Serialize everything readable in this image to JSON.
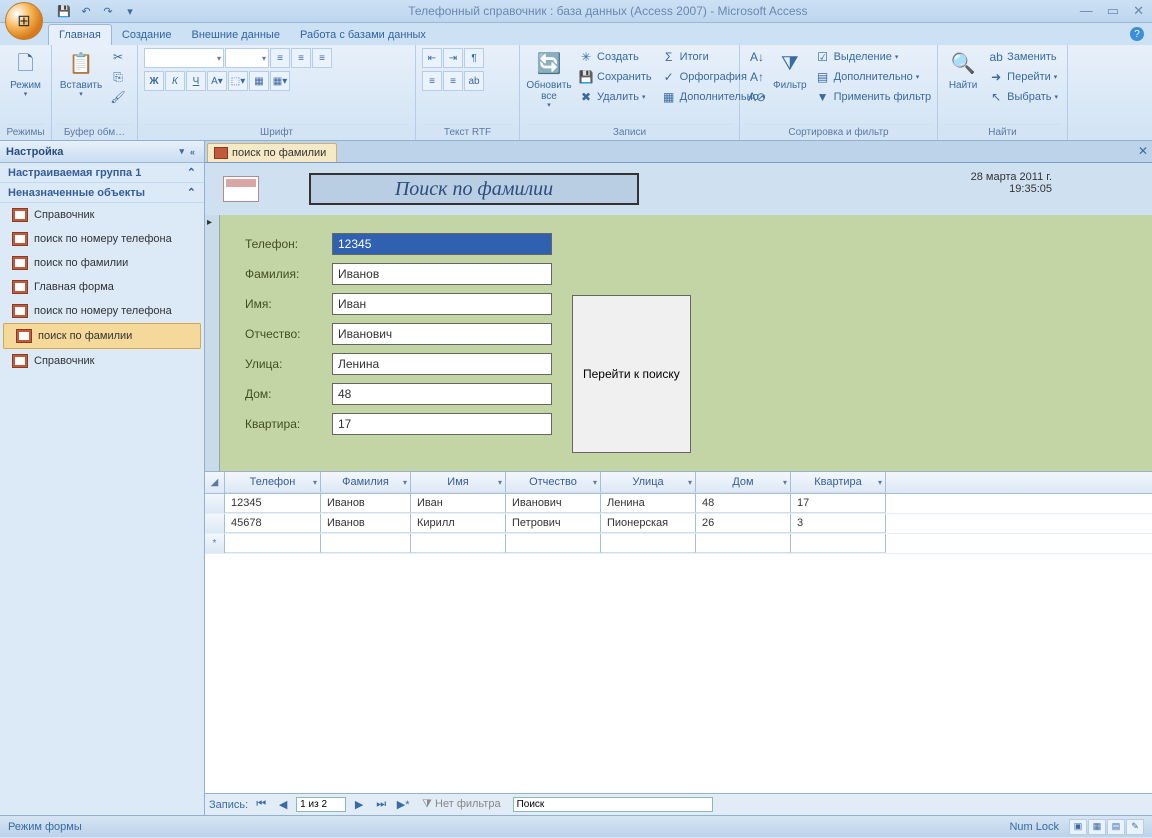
{
  "titlebar": {
    "title": "Телефонный справочник : база данных (Access 2007) - Microsoft Access"
  },
  "tabs": {
    "t1": "Главная",
    "t2": "Создание",
    "t3": "Внешние данные",
    "t4": "Работа с базами данных"
  },
  "ribbon": {
    "g_modes": "Режимы",
    "g_clip": "Буфер обм…",
    "g_font": "Шрифт",
    "g_rtf": "Текст RTF",
    "g_rec": "Записи",
    "g_sort": "Сортировка и фильтр",
    "g_find": "Найти",
    "mode": "Режим",
    "paste": "Вставить",
    "refresh": "Обновить все",
    "filter": "Фильтр",
    "find": "Найти",
    "new": "Создать",
    "save": "Сохранить",
    "delete": "Удалить",
    "totals": "Итоги",
    "spell": "Орфография",
    "more": "Дополнительно",
    "sel": "Выделение",
    "adv": "Дополнительно",
    "togf": "Применить фильтр",
    "replace": "Заменить",
    "goto": "Перейти",
    "select": "Выбрать"
  },
  "nav": {
    "hdr": "Настройка",
    "grp1": "Настраиваемая группа 1",
    "grp2": "Неназначенные объекты",
    "items": [
      "Справочник",
      "поиск по номеру телефона",
      "поиск по фамилии",
      "Главная форма",
      "поиск по номеру телефона",
      "поиск по фамилии",
      "Справочник"
    ]
  },
  "doctab": "поиск по фамилии",
  "form": {
    "title": "Поиск по фамилии",
    "date": "28 марта 2011 г.",
    "time": "19:35:05",
    "lbl_phone": "Телефон:",
    "lbl_fam": "Фамилия:",
    "lbl_name": "Имя:",
    "lbl_ot": "Отчество:",
    "lbl_st": "Улица:",
    "lbl_dom": "Дом:",
    "lbl_kv": "Квартира:",
    "v_phone": "12345",
    "v_fam": "Иванов",
    "v_name": "Иван",
    "v_ot": "Иванович",
    "v_st": "Ленина",
    "v_dom": "48",
    "v_kv": "17",
    "btn": "Перейти к поиску"
  },
  "table": {
    "hdr": [
      "Телефон",
      "Фамилия",
      "Имя",
      "Отчество",
      "Улица",
      "Дом",
      "Квартира"
    ],
    "rows": [
      [
        "12345",
        "Иванов",
        "Иван",
        "Иванович",
        "Ленина",
        "48",
        "17"
      ],
      [
        "45678",
        "Иванов",
        "Кирилл",
        "Петрович",
        "Пионерская",
        "26",
        "3"
      ]
    ]
  },
  "recnav": {
    "label": "Запись:",
    "pos": "1 из 2",
    "nofilter": "Нет фильтра",
    "search": "Поиск"
  },
  "status": {
    "mode": "Режим формы",
    "numlock": "Num Lock"
  }
}
